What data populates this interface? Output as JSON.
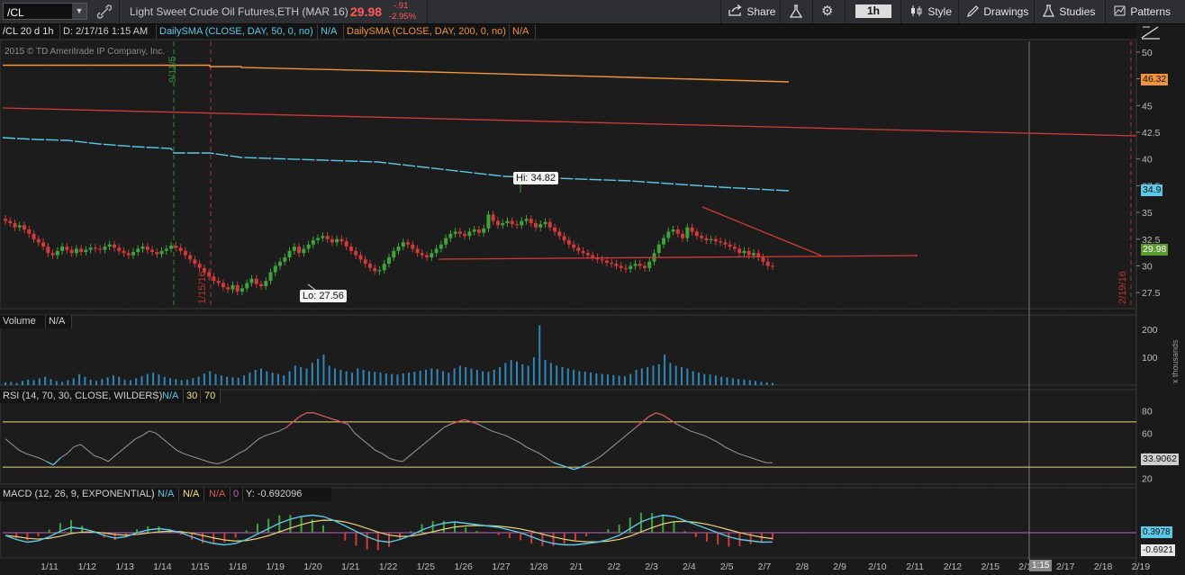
{
  "toolbar": {
    "symbol": "/CL",
    "description": "Light Sweet Crude Oil Futures,ETH (MAR 16)",
    "last": "29.98",
    "change": "-.91",
    "change_pct": "-2.95%",
    "share": "Share",
    "interval": "1h",
    "style": "Style",
    "drawings": "Drawings",
    "studies": "Studies",
    "patterns": "Patterns"
  },
  "infobar": {
    "timeframe": "/CL 20 d 1h",
    "cursor": "D: 2/17/16 1:15 AM",
    "sma50": "DailySMA (CLOSE, DAY, 50, 0, no)",
    "sma50_val": "N/A",
    "sma200": "DailySMA (CLOSE, DAY, 200, 0, no)",
    "sma200_val": "N/A"
  },
  "copyright": "2015 © TD Ameritrade IP Company, Inc.",
  "chart_data": {
    "type": "candlestick",
    "price_axis": [
      "50",
      "47.5",
      "45",
      "42.5",
      "40",
      "37.5",
      "35",
      "32.5",
      "30",
      "27.5"
    ],
    "ylim": [
      26,
      51
    ],
    "tags": {
      "sma200": "46.32",
      "sma50": "34.9",
      "last": "29.98"
    },
    "high_label": "Hi: 34.82",
    "low_label": "Lo: 27.56",
    "vlines": [
      "9/11/5",
      "1/15/16",
      "2/19/16"
    ],
    "x_dates": [
      "1/11",
      "1/12",
      "1/13",
      "1/14",
      "1/15",
      "1/18",
      "1/19",
      "1/20",
      "1/21",
      "1/22",
      "1/25",
      "1/26",
      "1/27",
      "1/28",
      "2/1",
      "2/2",
      "2/3",
      "2/4",
      "2/5",
      "2/7",
      "2/8",
      "2/9",
      "2/10",
      "2/11",
      "2/12",
      "2/15",
      "2/16",
      "2/17",
      "2/18",
      "2/19"
    ],
    "cursor_time": "1:15",
    "closes": [
      34.2,
      34.0,
      33.6,
      33.8,
      33.4,
      33.0,
      32.5,
      32.2,
      31.8,
      31.2,
      31.0,
      31.4,
      31.8,
      31.5,
      31.2,
      31.6,
      31.3,
      31.5,
      31.7,
      31.6,
      31.5,
      31.8,
      32.0,
      31.7,
      31.4,
      31.2,
      31.0,
      31.3,
      31.6,
      31.8,
      31.5,
      31.3,
      31.1,
      31.4,
      31.6,
      31.9,
      31.7,
      31.4,
      31.0,
      30.6,
      30.2,
      29.8,
      29.4,
      29.0,
      28.6,
      28.4,
      28.0,
      27.8,
      28.2,
      27.6,
      27.9,
      28.4,
      28.8,
      28.3,
      28.1,
      28.6,
      29.4,
      30.0,
      30.4,
      30.8,
      31.4,
      31.8,
      31.2,
      31.6,
      32.0,
      32.4,
      32.6,
      32.8,
      32.5,
      32.2,
      32.5,
      32.3,
      31.8,
      31.4,
      31.0,
      30.6,
      30.2,
      29.8,
      29.5,
      29.6,
      30.2,
      30.8,
      31.4,
      31.8,
      32.2,
      32.0,
      31.6,
      31.2,
      31.0,
      30.8,
      31.2,
      31.6,
      32.0,
      32.6,
      33.0,
      33.2,
      33.0,
      32.8,
      33.2,
      33.4,
      33.1,
      33.5,
      34.8,
      34.2,
      33.8,
      34.0,
      34.2,
      33.9,
      33.8,
      34.2,
      34.4,
      34.0,
      33.6,
      33.9,
      34.1,
      33.6,
      33.2,
      32.8,
      32.4,
      32.0,
      31.7,
      31.4,
      31.2,
      31.0,
      30.8,
      30.6,
      30.5,
      30.3,
      30.2,
      30.0,
      29.8,
      29.7,
      30.0,
      30.2,
      30.0,
      29.8,
      30.4,
      31.2,
      32.0,
      32.6,
      33.2,
      33.4,
      33.0,
      32.6,
      33.6,
      33.2,
      32.8,
      32.6,
      32.4,
      32.5,
      32.3,
      32.2,
      32.0,
      31.8,
      31.6,
      31.2,
      31.4,
      31.0,
      31.2,
      30.8,
      30.4,
      30.0,
      29.98
    ],
    "volume_axis": [
      "200",
      "100"
    ],
    "volume_unit": "x thousands",
    "volumes": [
      10,
      12,
      8,
      15,
      20,
      18,
      25,
      30,
      22,
      15,
      12,
      18,
      25,
      40,
      30,
      20,
      15,
      22,
      28,
      35,
      30,
      20,
      18,
      25,
      32,
      40,
      45,
      38,
      30,
      25,
      22,
      18,
      20,
      25,
      30,
      42,
      50,
      40,
      35,
      30,
      28,
      26,
      35,
      45,
      55,
      60,
      50,
      45,
      40,
      35,
      50,
      70,
      65,
      60,
      80,
      95,
      110,
      70,
      60,
      55,
      50,
      45,
      60,
      55,
      50,
      48,
      45,
      42,
      40,
      38,
      42,
      45,
      48,
      52,
      55,
      60,
      58,
      50,
      45,
      60,
      70,
      65,
      60,
      55,
      50,
      48,
      55,
      65,
      80,
      90,
      85,
      75,
      70,
      100,
      215,
      90,
      80,
      70,
      65,
      60,
      55,
      50,
      48,
      45,
      42,
      40,
      38,
      36,
      34,
      32,
      40,
      55,
      60,
      65,
      70,
      75,
      110,
      80,
      70,
      65,
      60,
      50,
      45,
      40,
      38,
      35,
      30,
      28,
      25,
      22,
      20,
      18,
      15,
      12,
      10,
      8
    ],
    "rsi_label": "RSI (14, 70, 30, CLOSE, WILDERS)",
    "rsi_value": "N/A",
    "rsi_levels": [
      "30",
      "70"
    ],
    "rsi_axis": [
      "80",
      "60",
      "40",
      "20"
    ],
    "rsi_tag": "33.9062",
    "rsi": [
      55,
      50,
      45,
      42,
      40,
      38,
      35,
      32,
      38,
      42,
      48,
      50,
      45,
      40,
      38,
      35,
      40,
      45,
      50,
      55,
      58,
      62,
      60,
      55,
      50,
      45,
      42,
      40,
      38,
      36,
      34,
      33,
      35,
      38,
      42,
      45,
      50,
      55,
      58,
      60,
      62,
      65,
      70,
      75,
      78,
      78,
      76,
      74,
      72,
      70,
      68,
      60,
      55,
      50,
      45,
      42,
      38,
      36,
      35,
      40,
      45,
      50,
      55,
      60,
      65,
      68,
      70,
      72,
      70,
      68,
      65,
      62,
      60,
      58,
      55,
      52,
      48,
      45,
      42,
      38,
      34,
      32,
      30,
      28,
      30,
      33,
      36,
      40,
      45,
      50,
      55,
      60,
      65,
      70,
      75,
      78,
      76,
      72,
      68,
      65,
      62,
      60,
      58,
      55,
      52,
      48,
      45,
      42,
      40,
      38,
      36,
      34,
      33.9
    ],
    "macd_label": "MACD (12, 26, 9, EXPONENTIAL)",
    "macd_values": [
      "N/A",
      "N/A",
      "N/A",
      "0"
    ],
    "macd_readout": "Y: -0.692096",
    "macd_axis": [
      "0"
    ],
    "macd_tags": [
      "0.3978",
      "-0.6921"
    ],
    "macd": [
      -0.2,
      -0.5,
      -0.7,
      -0.6,
      -0.3,
      0.1,
      0.4,
      0.3,
      0.1,
      -0.2,
      -0.4,
      -0.3,
      0.0,
      0.2,
      0.3,
      0.2,
      0.0,
      -0.3,
      -0.6,
      -0.8,
      -0.9,
      -0.8,
      -0.5,
      -0.1,
      0.3,
      0.7,
      1.0,
      1.2,
      1.3,
      1.2,
      0.9,
      0.5,
      0.1,
      -0.3,
      -0.6,
      -0.7,
      -0.5,
      -0.2,
      0.2,
      0.5,
      0.7,
      0.8,
      0.7,
      0.6,
      0.5,
      0.4,
      0.2,
      0.0,
      -0.3,
      -0.6,
      -0.8,
      -0.9,
      -0.9,
      -0.8,
      -0.7,
      -0.5,
      -0.2,
      0.3,
      0.8,
      1.1,
      1.3,
      1.2,
      0.9,
      0.6,
      0.3,
      0.0,
      -0.3,
      -0.5,
      -0.6,
      -0.7,
      -0.69
    ]
  }
}
